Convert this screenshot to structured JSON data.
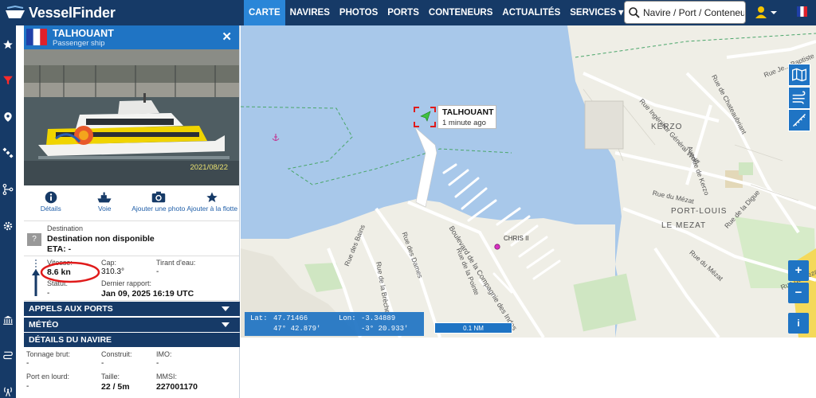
{
  "app": {
    "logo_text": "VesselFinder"
  },
  "nav": {
    "items": [
      {
        "label": "CARTE",
        "active": true
      },
      {
        "label": "NAVIRES"
      },
      {
        "label": "PHOTOS"
      },
      {
        "label": "PORTS"
      },
      {
        "label": "CONTENEURS"
      },
      {
        "label": "ACTUALITÉS"
      },
      {
        "label": "SERVICES ▾"
      }
    ],
    "search_placeholder": "Navire / Port / Conteneur"
  },
  "rail": {
    "icons": [
      "star-icon",
      "filter-icon",
      "location-pin-icon",
      "satellite-icon",
      "route-icon",
      "gear-icon",
      "port-icon",
      "track-icon",
      "antenna-icon"
    ]
  },
  "vessel": {
    "name": "TALHOUANT",
    "type": "Passenger ship",
    "photo_date": "2021/08/22",
    "actions": [
      {
        "label": "Détails",
        "icon": "info-icon"
      },
      {
        "label": "Voie",
        "icon": "ship-icon"
      },
      {
        "label": "Ajouter une photo",
        "icon": "camera-icon"
      },
      {
        "label": "Ajouter à la flotte",
        "icon": "star-icon"
      }
    ],
    "destination_label": "Destination",
    "destination_value": "Destination non disponible",
    "eta": "ETA: -",
    "dest_unknown_symbol": "?",
    "speed_label": "Vitesse:",
    "speed_value": "8.6 kn",
    "course_label": "Cap:",
    "course_value": "310.3°",
    "draught_label": "Tirant d'eau:",
    "draught_value": "-",
    "status_label": "Statut:",
    "status_value": "-",
    "last_report_label": "Dernier rapport:",
    "last_report_value": "Jan 09, 2025 16:19 UTC"
  },
  "sections": {
    "port_calls": "APPELS AUX PORTS",
    "weather": "MÉTÉO",
    "details": "DÉTAILS DU NAVIRE"
  },
  "details": {
    "gross_tonnage_label": "Tonnage brut:",
    "gross_tonnage_value": "-",
    "built_label": "Construit:",
    "built_value": "-",
    "imo_label": "IMO:",
    "imo_value": "-",
    "deadweight_label": "Port en lourd:",
    "deadweight_value": "-",
    "size_label": "Taille:",
    "size_value": "22 / 5m",
    "mmsi_label": "MMSI:",
    "mmsi_value": "227001170"
  },
  "map": {
    "popup_name": "TALHOUANT",
    "popup_time": "1 minute ago",
    "chris_label": "CHRIS II",
    "labels": {
      "kerzo": "KERZO",
      "port_louis": "PORT-LOUIS",
      "le_mezat": "LE MEZAT",
      "rue_ingenieur": "Rue Ingénieur Général Wolff",
      "rue_chateaubriant": "Rue de Chateaubriant",
      "rue_je_baptiste": "Rue Je... Baptiste",
      "rue_du_mezat": "Rue du Mézat",
      "avenue_kerzo": "Avenue de Kerzo",
      "rue_dames": "Rue des Dames",
      "rue_bains": "Rue des Bains",
      "rue_breche": "Rue de la Brèche",
      "rue_pointe": "Rue de la Pointe",
      "boulevard": "Boulevard de la Compagnie des Indes",
      "rue_digue": "Rue de la Digue",
      "rue_mezat_2": "Rue du Mézat",
      "rue_mezat_3": "Rue du Mézat"
    },
    "coords": {
      "lat_label": "Lat:",
      "lat_dec": "47.71466",
      "lon_label": "Lon:",
      "lon_dec": "-3.34889",
      "lat_dms": "47° 42.879'",
      "lon_dms": "-3° 20.933'"
    },
    "scale": "0.1 NM",
    "tool_icons": [
      "map-layers-icon",
      "wind-icon",
      "ruler-icon"
    ],
    "zoom_in": "+",
    "zoom_out": "−",
    "info": "i"
  },
  "colors": {
    "navbar": "#163a67",
    "accent": "#1f74c4",
    "water": "#a8c8ea",
    "land": "#efeee6",
    "vessel_marker": "#3fc23f",
    "highlight_circle": "#e01b1b"
  }
}
